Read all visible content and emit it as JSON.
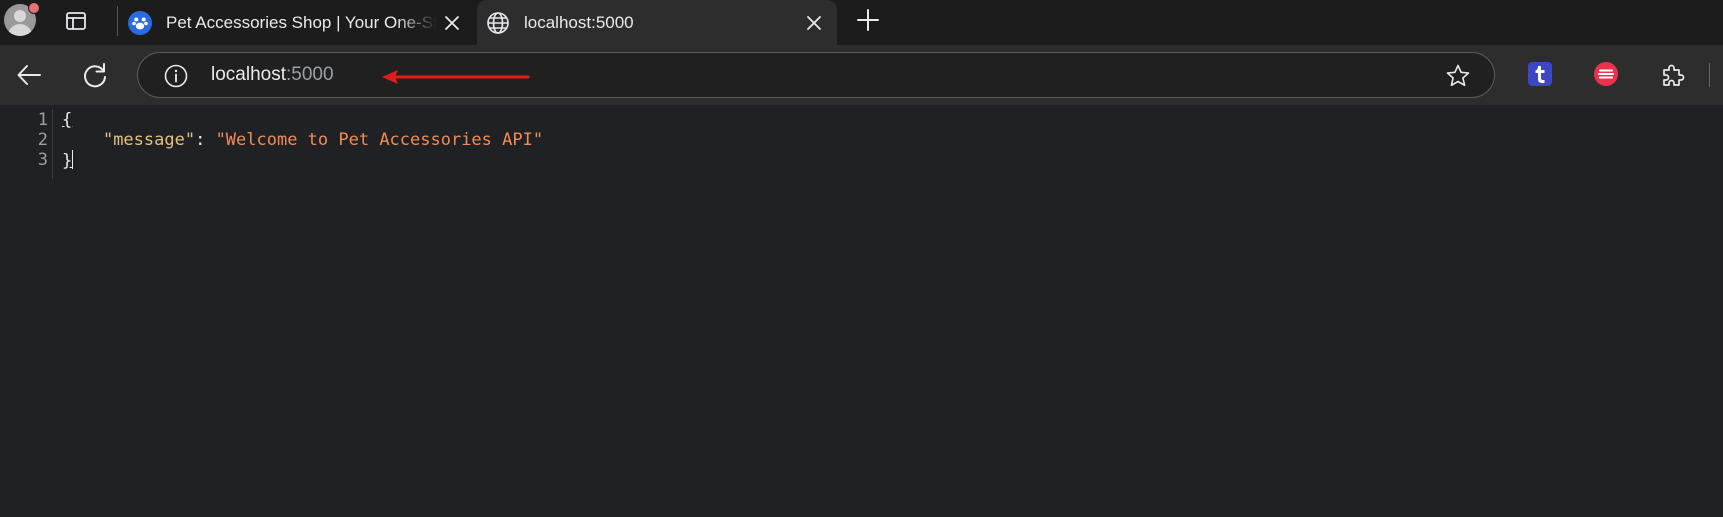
{
  "tabs": [
    {
      "title": "Pet Accessories Shop | Your One-Stop Shop",
      "favicon": "paw-icon",
      "active": false
    },
    {
      "title": "localhost:5000",
      "favicon": "globe-icon",
      "active": true
    }
  ],
  "toolbar": {
    "url_host": "localhost",
    "url_port": ":5000"
  },
  "extensions": [
    "tumblr-icon",
    "red-extension-icon",
    "extensions-puzzle-icon"
  ],
  "json_view": {
    "line_numbers": [
      "1",
      "2",
      "3"
    ],
    "open_brace": "{",
    "close_brace": "}",
    "key": "\"message\"",
    "colon": ": ",
    "value": "\"Welcome to Pet Accessories API\""
  },
  "colors": {
    "annotation_arrow": "#e21b1b",
    "json_key": "#e5c07b",
    "json_string": "#f28b54",
    "background": "#202124"
  }
}
